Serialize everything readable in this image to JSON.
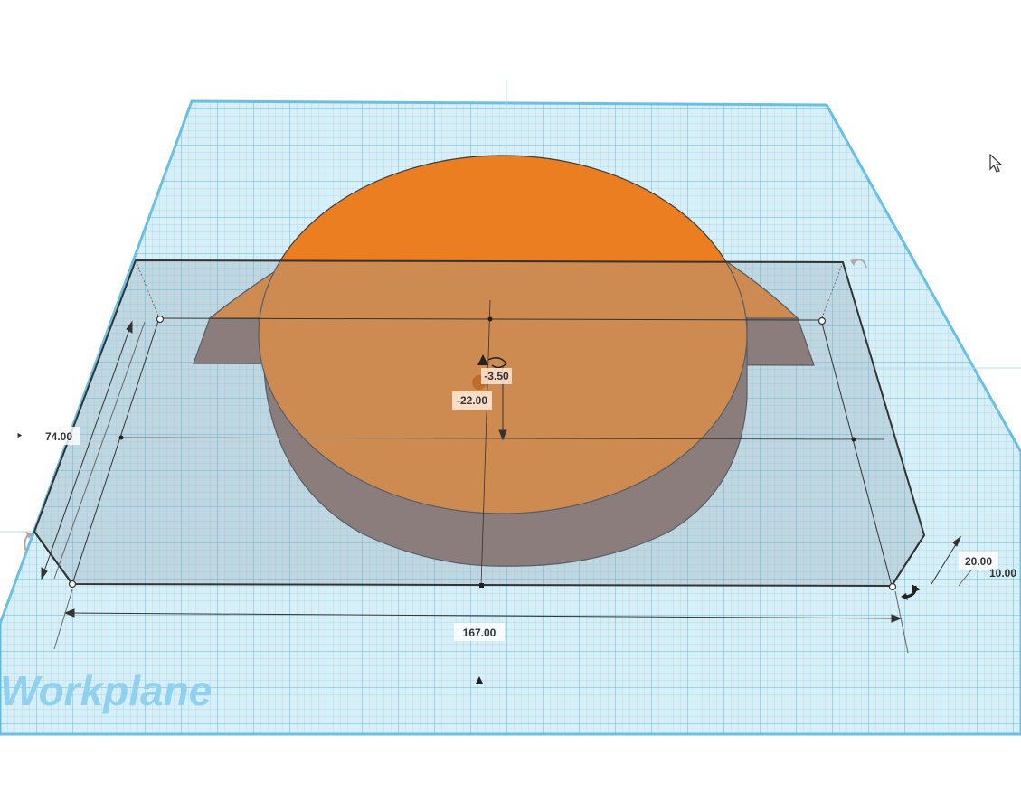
{
  "workplane": {
    "label": "Workplane",
    "grid_color": "#5bb8dd",
    "fill_color": "#d3ecf6"
  },
  "shape": {
    "color": "#ec7e22",
    "side_color": "#8a6a62"
  },
  "dimensions": {
    "width": "167.00",
    "depth": "74.00",
    "height": "20.00",
    "height_elevation": "10.00",
    "offset_x": "-22.00",
    "offset_y": "-3.50"
  },
  "icons": {
    "rotate_handle": "rotate-arrow-icon",
    "lift_handle": "cone-lift-icon",
    "cursor": "mouse-pointer-icon"
  }
}
